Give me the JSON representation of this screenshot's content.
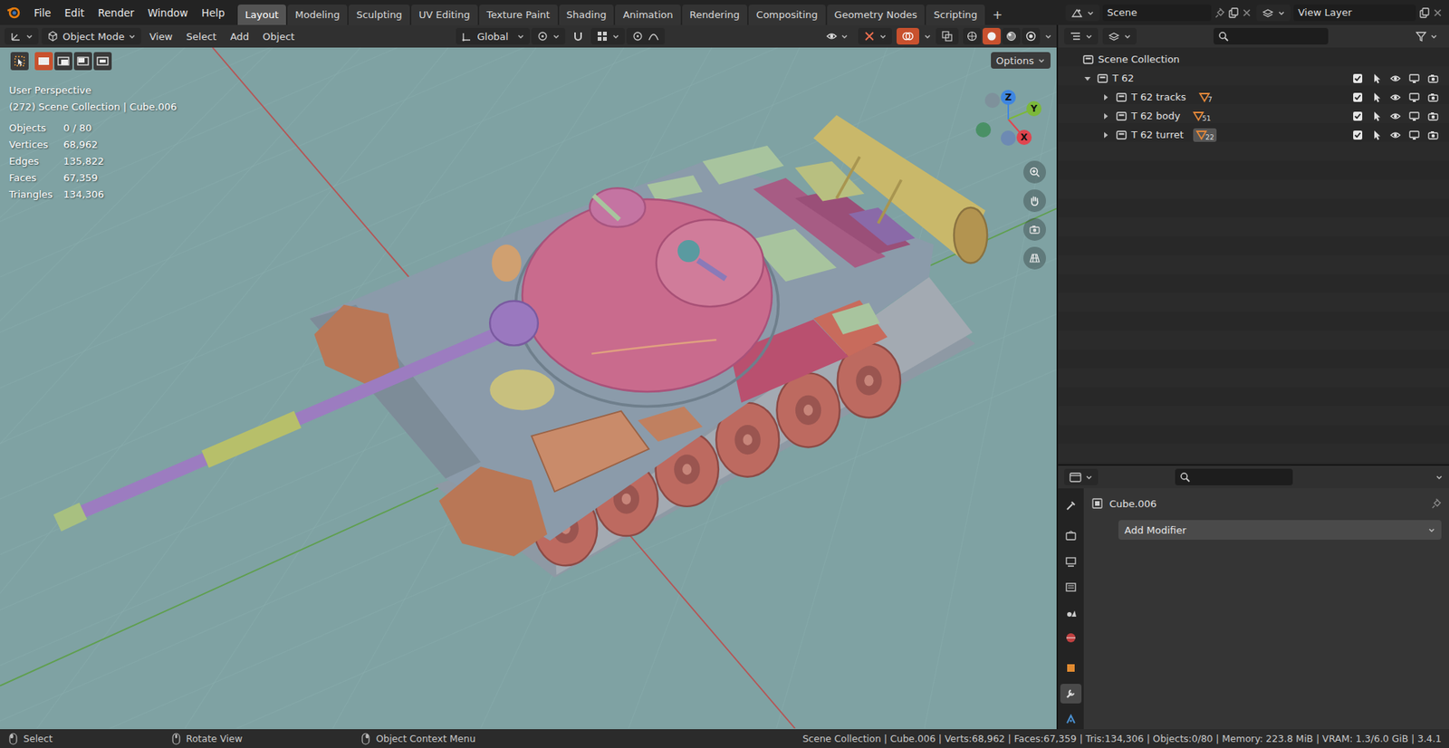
{
  "menu": [
    "File",
    "Edit",
    "Render",
    "Window",
    "Help"
  ],
  "workspace_tabs": [
    {
      "label": "Layout",
      "selected": true
    },
    {
      "label": "Modeling",
      "selected": false
    },
    {
      "label": "Sculpting",
      "selected": false
    },
    {
      "label": "UV Editing",
      "selected": false
    },
    {
      "label": "Texture Paint",
      "selected": false
    },
    {
      "label": "Shading",
      "selected": false
    },
    {
      "label": "Animation",
      "selected": false
    },
    {
      "label": "Rendering",
      "selected": false
    },
    {
      "label": "Compositing",
      "selected": false
    },
    {
      "label": "Geometry Nodes",
      "selected": false
    },
    {
      "label": "Scripting",
      "selected": false
    }
  ],
  "add_workspace": "+",
  "scene": "Scene",
  "view_layer": "View Layer",
  "viewport": {
    "mode": "Object Mode",
    "menus": [
      "View",
      "Select",
      "Add",
      "Object"
    ],
    "orientation": "Global",
    "options": "Options",
    "select_modes": [
      {
        "selected": true
      },
      {
        "selected": false
      },
      {
        "selected": false
      },
      {
        "selected": false
      }
    ],
    "shading": [
      {
        "selected": false
      },
      {
        "selected": true
      },
      {
        "selected": false
      },
      {
        "selected": false
      }
    ],
    "view_name": "User Perspective",
    "context": "(272) Scene Collection | Cube.006",
    "stats": [
      {
        "label": "Objects",
        "value": "0 / 80"
      },
      {
        "label": "Vertices",
        "value": "68,962"
      },
      {
        "label": "Edges",
        "value": "135,822"
      },
      {
        "label": "Faces",
        "value": "67,359"
      },
      {
        "label": "Triangles",
        "value": "134,306"
      }
    ],
    "gizmo": [
      {
        "label": "X",
        "color": "#e0454f"
      },
      {
        "label": "Y",
        "color": "#7cb83a"
      },
      {
        "label": "Z",
        "color": "#3f86e0"
      }
    ]
  },
  "outliner": {
    "root": "Scene Collection",
    "collections": [
      {
        "name": "T 62",
        "expanded": true,
        "checked": true,
        "children": [
          {
            "name": "T 62 tracks",
            "count": "7",
            "expanded": false,
            "checked": true,
            "active": false
          },
          {
            "name": "T 62 body",
            "count": "51",
            "expanded": false,
            "checked": true,
            "active": false
          },
          {
            "name": "T 62 turret",
            "count": "22",
            "expanded": false,
            "checked": true,
            "active": true
          }
        ]
      }
    ]
  },
  "properties": {
    "object": "Cube.006",
    "add_modifier": "Add Modifier",
    "tabs": [
      {
        "selected": false
      },
      {
        "selected": false
      },
      {
        "selected": false
      },
      {
        "selected": false
      },
      {
        "selected": false
      },
      {
        "selected": false
      },
      {
        "selected": false
      },
      {
        "selected": true
      },
      {
        "selected": false
      }
    ]
  },
  "status_bar": {
    "hints": [
      "Select",
      "Rotate View",
      "Object Context Menu"
    ],
    "info": "Scene Collection | Cube.006 | Verts:68,962 | Faces:67,359 | Tris:134,306 | Objects:0/80 | Memory: 223.8 MiB | VRAM: 1.3/6.0 GiB | 3.4.1"
  }
}
